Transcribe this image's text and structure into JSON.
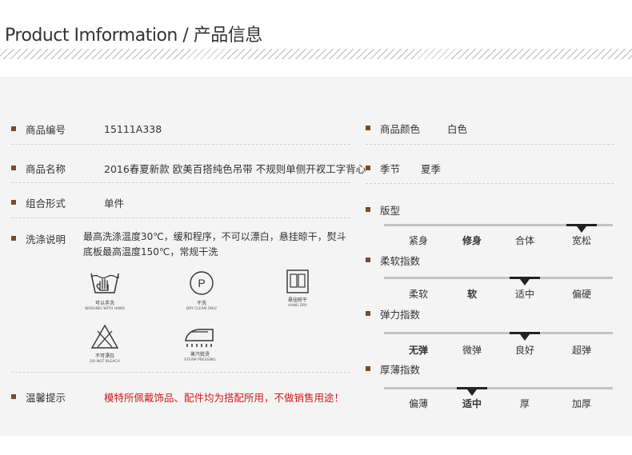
{
  "header": {
    "title": "Product Imformation / 产品信息"
  },
  "left": {
    "code": {
      "label": "商品编号",
      "value": "15111A338"
    },
    "name": {
      "label": "商品名称",
      "value": "2016春夏新款 欧美百搭纯色吊带 不规则单侧开衩工字背心"
    },
    "combo": {
      "label": "组合形式",
      "value": "单件"
    },
    "care": {
      "label": "洗涤说明",
      "value": "最高洗涤温度30℃，缓和程序，不可以漂白，悬挂晾干，熨斗底板最高温度150℃，常规干洗"
    },
    "tip": {
      "label": "温馨提示",
      "value": "模特所佩戴饰品、配件均为搭配所用，不做销售用途！",
      "color": "#c81e1e"
    }
  },
  "care_icons": [
    {
      "name": "hand-wash-icon",
      "cn": "可以手洗",
      "en": "WASHING WITH HAND"
    },
    {
      "name": "dry-clean-icon",
      "cn": "干洗",
      "en": "DRY CLEAN ONLY",
      "glyph": "P"
    },
    {
      "name": "hang-dry-icon",
      "cn": "悬挂晾干",
      "en": "HANG DRY"
    },
    {
      "name": "no-bleach-icon",
      "cn": "不可漂白",
      "en": "DO NOT BLEACH"
    },
    {
      "name": "steam-iron-icon",
      "cn": "蒸汽熨烫",
      "en": "STEAM PRESSING"
    }
  ],
  "right": {
    "color": {
      "label": "商品颜色",
      "value": "白色"
    },
    "season": {
      "label": "季节",
      "value": "夏季"
    },
    "scales": [
      {
        "title": "版型",
        "options": [
          "紧身",
          "修身",
          "合体",
          "宽松"
        ],
        "bold_index": 1,
        "selected_index": 3
      },
      {
        "title": "柔软指数",
        "options": [
          "柔软",
          "软",
          "适中",
          "偏硬"
        ],
        "bold_index": 1,
        "selected_index": 2
      },
      {
        "title": "弹力指数",
        "options": [
          "无弹",
          "微弹",
          "良好",
          "超弹"
        ],
        "bold_index": 0,
        "selected_index": 2
      },
      {
        "title": "厚薄指数",
        "options": [
          "偏薄",
          "适中",
          "厚",
          "加厚"
        ],
        "bold_index": 1,
        "selected_index": 1
      }
    ]
  },
  "colors": {
    "bullet": "#7a4a2a",
    "accent_red": "#c81e1e",
    "panel_bg": "#f4f4f4"
  }
}
